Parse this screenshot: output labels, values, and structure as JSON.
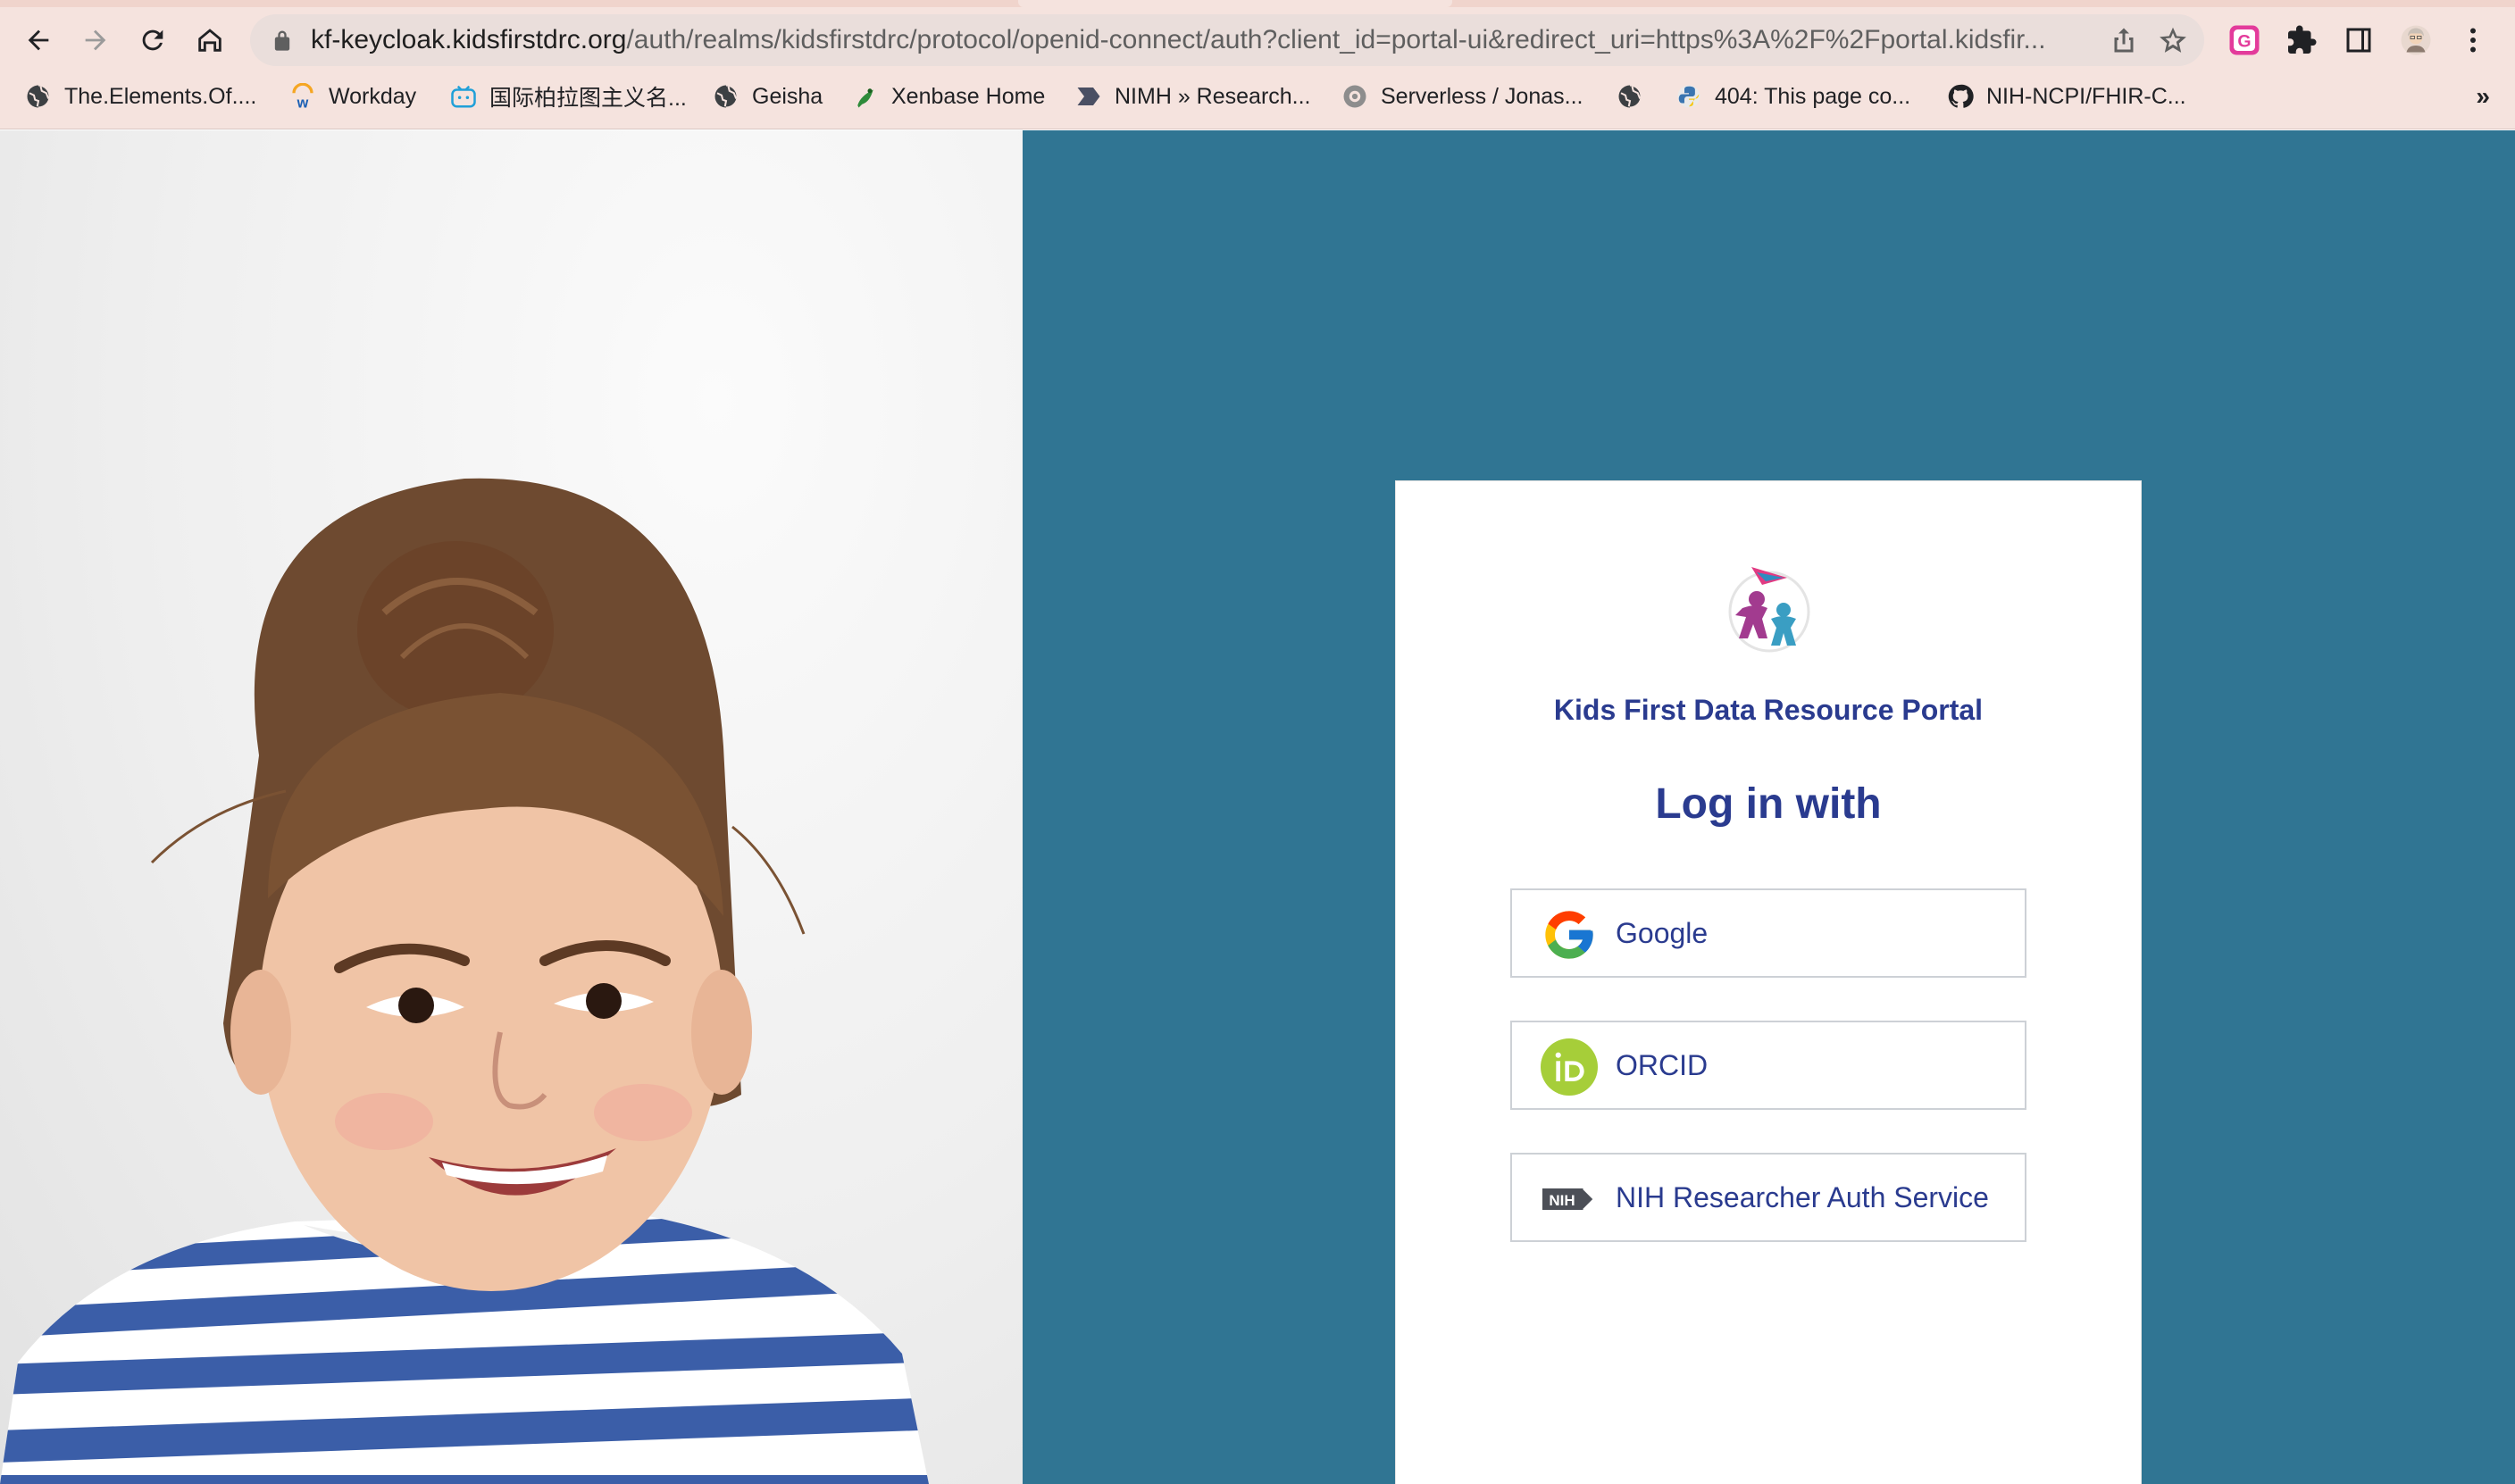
{
  "browser": {
    "url_host": "kf-keycloak.kidsfirstdrc.org",
    "url_path": "/auth/realms/kidsfirstdrc/protocol/openid-connect/auth?client_id=portal-ui&redirect_uri=https%3A%2F%2Fportal.kidsfir...",
    "nav": {
      "back_icon": "arrow-left-icon",
      "forward_icon": "arrow-right-icon",
      "reload_icon": "reload-icon",
      "home_icon": "home-icon"
    },
    "bookmarks": [
      {
        "label": "The.Elements.Of....",
        "icon": "globe-icon"
      },
      {
        "label": "Workday",
        "icon": "workday-icon"
      },
      {
        "label": "国际柏拉图主义名...",
        "icon": "bilibili-icon"
      },
      {
        "label": "Geisha",
        "icon": "globe-icon"
      },
      {
        "label": "Xenbase Home",
        "icon": "frog-icon"
      },
      {
        "label": "NIMH » Research...",
        "icon": "nimh-icon"
      },
      {
        "label": "Serverless / Jonas...",
        "icon": "serverless-icon"
      },
      {
        "label": "",
        "icon": "globe-icon"
      },
      {
        "label": "404: This page co...",
        "icon": "python-icon"
      },
      {
        "label": "NIH-NCPI/FHIR-C...",
        "icon": "github-icon"
      }
    ],
    "bookmarks_overflow": "»"
  },
  "login": {
    "portal_name": "Kids First Data Resource Portal",
    "title": "Log in with",
    "providers": [
      {
        "label": "Google",
        "icon": "google-icon"
      },
      {
        "label": "ORCID",
        "icon": "orcid-icon"
      },
      {
        "label": "NIH Researcher Auth Service",
        "icon": "nih-icon",
        "icon_text": "NIH"
      }
    ]
  },
  "colors": {
    "login_background": "#307593",
    "brand_text": "#2a3b8f",
    "chrome": "#f5e3de"
  }
}
